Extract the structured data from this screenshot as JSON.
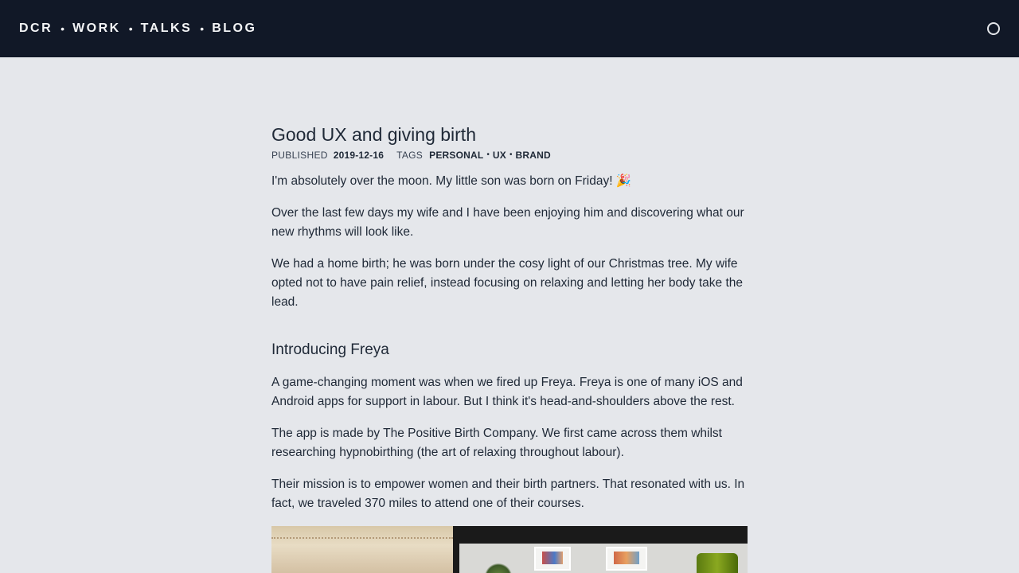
{
  "nav": {
    "items": [
      {
        "label": "DCR"
      },
      {
        "label": "WORK"
      },
      {
        "label": "TALKS"
      },
      {
        "label": "BLOG"
      }
    ],
    "separator": "•",
    "theme_toggle_icon": "circle-icon"
  },
  "article": {
    "title": "Good UX and giving birth",
    "published_label": "PUBLISHED",
    "published_date": "2019-12-16",
    "tags_label": "TAGS",
    "tags": [
      "PERSONAL",
      "UX",
      "BRAND"
    ],
    "tag_separator": "•",
    "paragraphs_intro": [
      "I'm absolutely over the moon. My little son was born on Friday! 🎉",
      "Over the last few days my wife and I have been enjoying him and discovering what our new rhythms will look like.",
      "We had a home birth; he was born under the cosy light of our Christmas tree. My wife opted not to have pain relief, instead focusing on relaxing and letting her body take the lead."
    ],
    "section_heading": "Introducing Freya",
    "paragraphs_section": [
      "A game-changing moment was when we fired up Freya. Freya is one of many iOS and Android apps for support in labour. But I think it's head-and-shoulders above the rest.",
      "The app is made by The Positive Birth Company. We first came across them whilst researching hypnobirthing (the art of relaxing throughout labour).",
      "Their mission is to empower women and their birth partners. That resonated with us. In fact, we traveled 370 miles to attend one of their courses."
    ]
  },
  "colors": {
    "topbar": "#111827",
    "background": "#e5e7eb",
    "text": "#1f2937"
  }
}
